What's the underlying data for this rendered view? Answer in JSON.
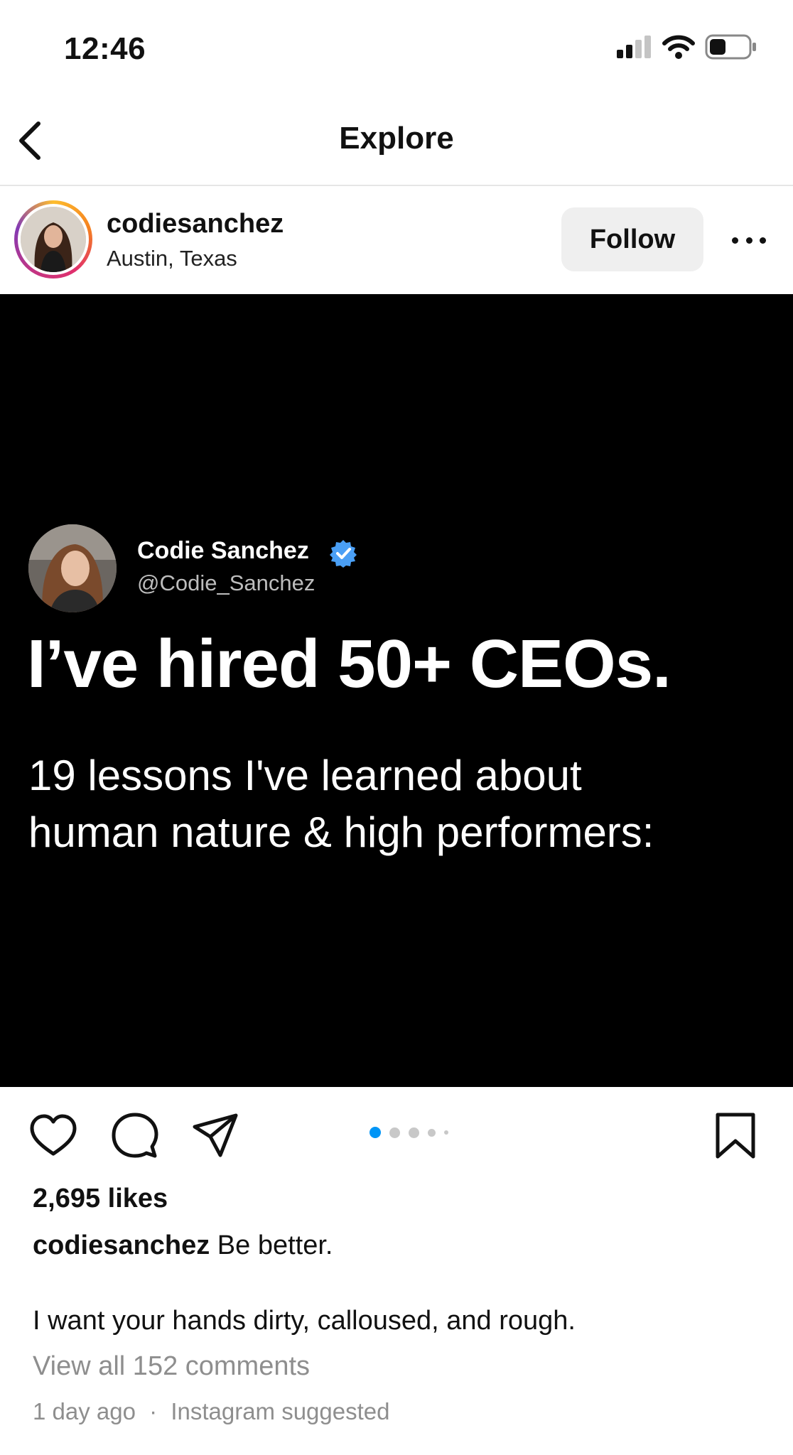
{
  "status_bar": {
    "time": "12:46",
    "icons": [
      "cellular-signal-icon",
      "wifi-icon",
      "battery-icon"
    ]
  },
  "nav": {
    "title": "Explore",
    "back_icon": "chevron-left-icon"
  },
  "post_header": {
    "username": "codiesanchez",
    "location": "Austin, Texas",
    "follow_label": "Follow",
    "more_icon": "more-horizontal-icon",
    "story_ring": true
  },
  "media": {
    "tweet_name": "Codie Sanchez",
    "tweet_handle": "@Codie_Sanchez",
    "verified": true,
    "headline": "I’ve hired 50+ CEOs.",
    "subline_1": "19 lessons I've learned about",
    "subline_2": "human nature & high performers:",
    "background": "#000000",
    "verified_color": "#4a9ff5"
  },
  "carousel": {
    "current_index": 1,
    "total_visible_dots": 5,
    "active_color": "#0095f6"
  },
  "actions": {
    "icons": [
      "heart-icon",
      "comment-icon",
      "share-icon",
      "bookmark-icon"
    ]
  },
  "engagement": {
    "likes": "2,695 likes",
    "caption_user": "codiesanchez",
    "caption_text": " Be better.",
    "caption_line2": "I want your hands dirty, calloused, and rough.",
    "view_comments": "View all 152 comments",
    "time_ago": "1 day ago",
    "separator": "·",
    "suggested": "Instagram suggested"
  }
}
